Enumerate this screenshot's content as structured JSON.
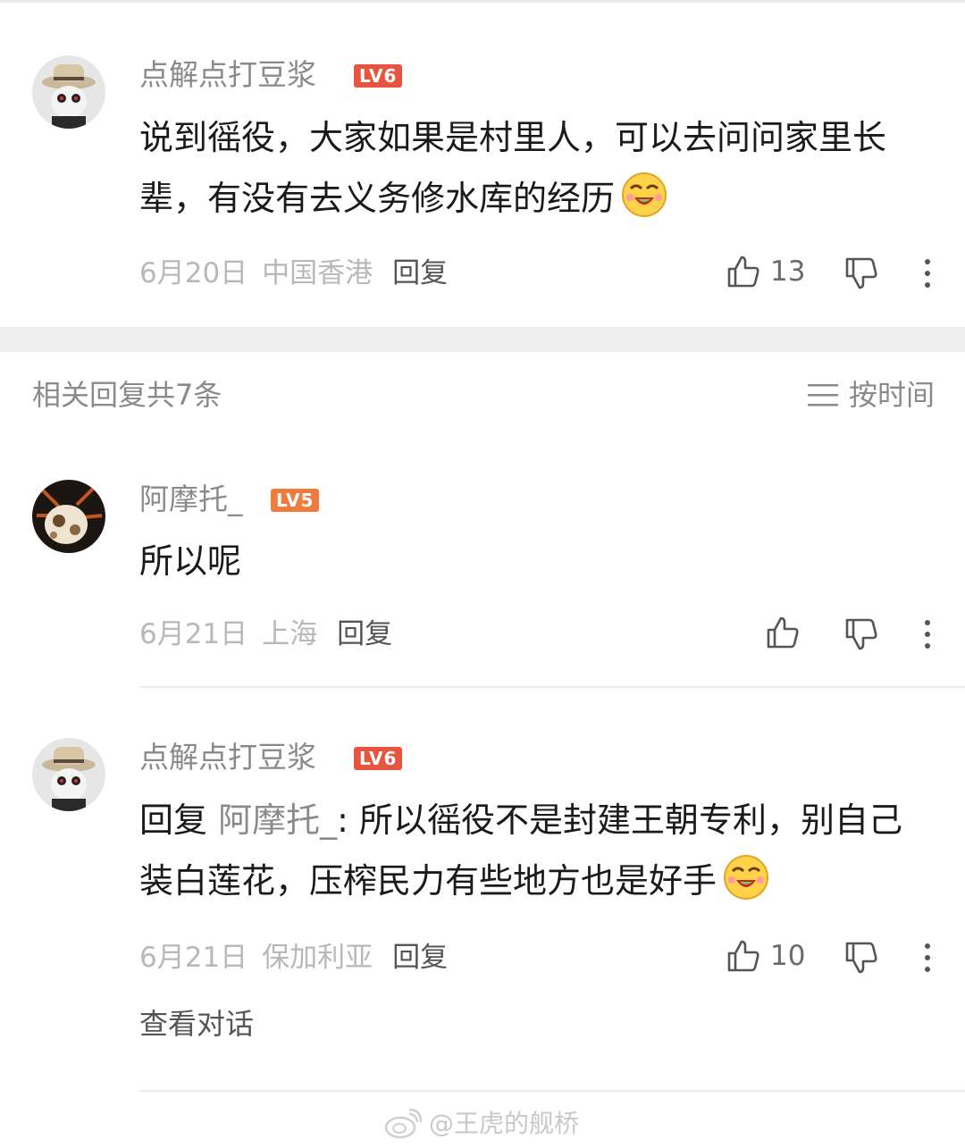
{
  "comments": [
    {
      "username": "点解点打豆浆",
      "level": "LV6",
      "text": "说到徭役，大家如果是村里人，可以去问问家里长辈，有没有去义务修水库的经历",
      "date": "6月20日",
      "location": "中国香港",
      "reply_label": "回复",
      "likes": "13"
    },
    {
      "username": "阿摩托_",
      "level": "LV5",
      "text": "所以呢",
      "date": "6月21日",
      "location": "上海",
      "reply_label": "回复",
      "likes": ""
    },
    {
      "username": "点解点打豆浆",
      "level": "LV6",
      "reply_prefix": "回复",
      "mention": "阿摩托_",
      "text": ": 所以徭役不是封建王朝专利，别自己装白莲花，压榨民力有些地方也是好手",
      "date": "6月21日",
      "location": "保加利亚",
      "reply_label": "回复",
      "likes": "10"
    }
  ],
  "section": {
    "title": "相关回复共7条",
    "sort_label": "按时间"
  },
  "view_conversation": "查看对话",
  "watermark": "@王虎的舰桥",
  "colors": {
    "lv6": "#e8553e",
    "lv5": "#ef7c3a",
    "text_gray": "#8a8a8a"
  },
  "icons": [
    "thumbs-up-icon",
    "thumbs-down-icon",
    "more-vertical-icon",
    "sort-lines-icon",
    "weibo-logo-icon",
    "grinning-emoji-icon"
  ]
}
